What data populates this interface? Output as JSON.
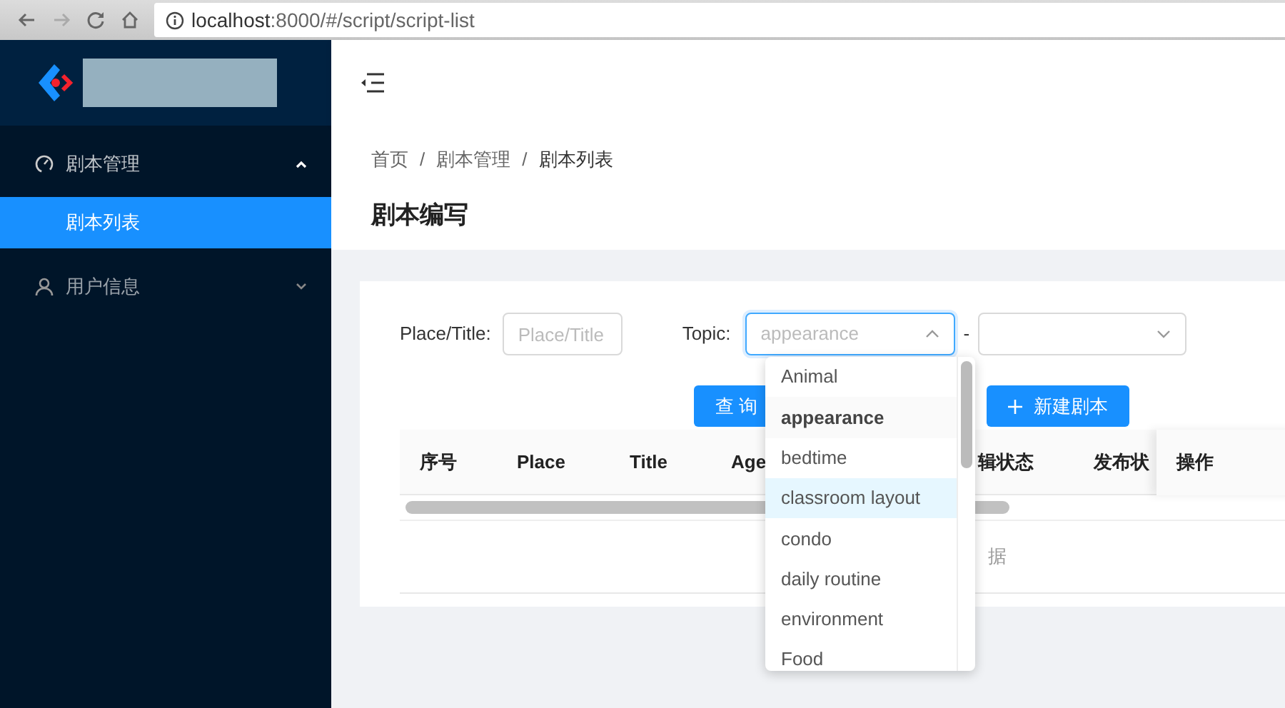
{
  "browser": {
    "url_host": "localhost",
    "url_rest": ":8000/#/script/script-list"
  },
  "sidebar": {
    "menus": [
      {
        "label": "剧本管理",
        "expanded": true,
        "children": [
          {
            "label": "剧本列表",
            "selected": true
          }
        ]
      },
      {
        "label": "用户信息",
        "expanded": false
      }
    ]
  },
  "breadcrumb": [
    "首页",
    "剧本管理",
    "剧本列表"
  ],
  "breadcrumb_separator": "/",
  "page_title": "剧本编写",
  "filters": {
    "place_title": {
      "label": "Place/Title",
      "colon": ":",
      "placeholder": "Place/Title"
    },
    "topic": {
      "label": "Topic",
      "colon": ":",
      "placeholder": "appearance",
      "open": true
    },
    "range_separator": "-"
  },
  "buttons": {
    "query": "查 询",
    "create": "新建剧本"
  },
  "table": {
    "columns": [
      "序号",
      "Place",
      "Title",
      "Age",
      "辑状态",
      "发布状",
      "操作"
    ],
    "empty_text": "据"
  },
  "topic_options": [
    {
      "label": "Animal",
      "selected": false,
      "hovered": false
    },
    {
      "label": "appearance",
      "selected": true,
      "hovered": false
    },
    {
      "label": "bedtime",
      "selected": false,
      "hovered": false
    },
    {
      "label": "classroom layout",
      "selected": false,
      "hovered": true
    },
    {
      "label": "condo",
      "selected": false,
      "hovered": false
    },
    {
      "label": "daily routine",
      "selected": false,
      "hovered": false
    },
    {
      "label": "environment",
      "selected": false,
      "hovered": false
    },
    {
      "label": "Food",
      "selected": false,
      "hovered": false
    }
  ]
}
